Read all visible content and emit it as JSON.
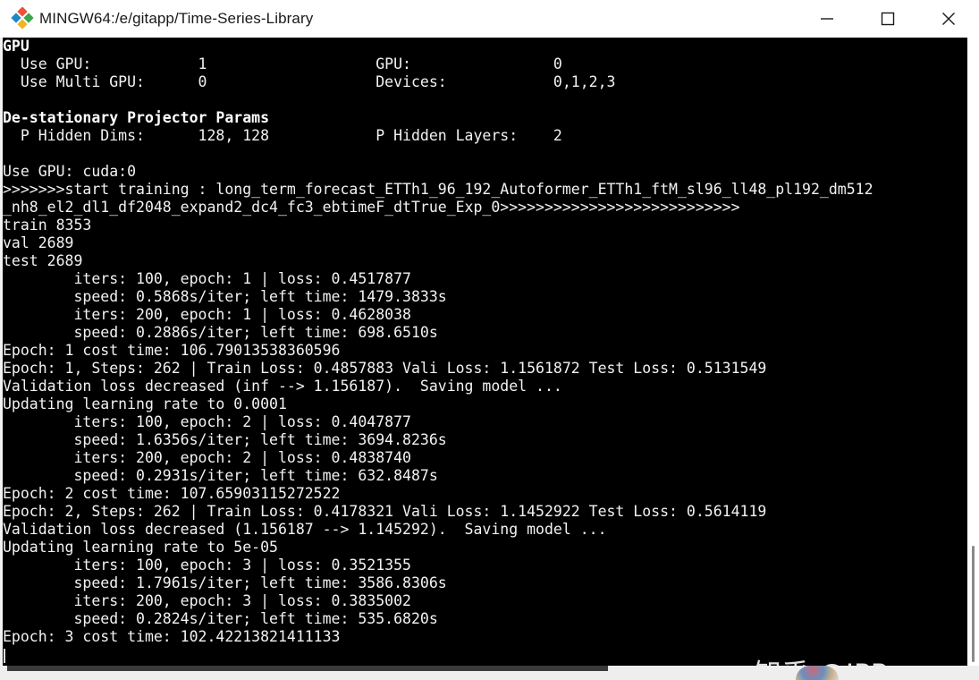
{
  "window": {
    "title": "MINGW64:/e/gitapp/Time-Series-Library",
    "app_icon": "git-bash-diamond-icon",
    "controls": {
      "minimize": "minimize-icon",
      "maximize": "maximize-icon",
      "close": "close-icon"
    }
  },
  "terminal": {
    "lines": [
      {
        "text": "GPU",
        "bold": true
      },
      {
        "text": "  Use GPU:            1                   GPU:                0",
        "bold": false
      },
      {
        "text": "  Use Multi GPU:      0                   Devices:            0,1,2,3",
        "bold": false
      },
      {
        "text": "",
        "bold": false
      },
      {
        "text": "De-stationary Projector Params",
        "bold": true
      },
      {
        "text": "  P Hidden Dims:      128, 128            P Hidden Layers:    2",
        "bold": false
      },
      {
        "text": "",
        "bold": false
      },
      {
        "text": "Use GPU: cuda:0",
        "bold": false
      },
      {
        "text": ">>>>>>>start training : long_term_forecast_ETTh1_96_192_Autoformer_ETTh1_ftM_sl96_ll48_pl192_dm512",
        "bold": false
      },
      {
        "text": "_nh8_el2_dl1_df2048_expand2_dc4_fc3_ebtimeF_dtTrue_Exp_0>>>>>>>>>>>>>>>>>>>>>>>>>>>",
        "bold": false
      },
      {
        "text": "train 8353",
        "bold": false
      },
      {
        "text": "val 2689",
        "bold": false
      },
      {
        "text": "test 2689",
        "bold": false
      },
      {
        "text": "        iters: 100, epoch: 1 | loss: 0.4517877",
        "bold": false
      },
      {
        "text": "        speed: 0.5868s/iter; left time: 1479.3833s",
        "bold": false
      },
      {
        "text": "        iters: 200, epoch: 1 | loss: 0.4628038",
        "bold": false
      },
      {
        "text": "        speed: 0.2886s/iter; left time: 698.6510s",
        "bold": false
      },
      {
        "text": "Epoch: 1 cost time: 106.79013538360596",
        "bold": false
      },
      {
        "text": "Epoch: 1, Steps: 262 | Train Loss: 0.4857883 Vali Loss: 1.1561872 Test Loss: 0.5131549",
        "bold": false
      },
      {
        "text": "Validation loss decreased (inf --> 1.156187).  Saving model ...",
        "bold": false
      },
      {
        "text": "Updating learning rate to 0.0001",
        "bold": false
      },
      {
        "text": "        iters: 100, epoch: 2 | loss: 0.4047877",
        "bold": false
      },
      {
        "text": "        speed: 1.6356s/iter; left time: 3694.8236s",
        "bold": false
      },
      {
        "text": "        iters: 200, epoch: 2 | loss: 0.4838740",
        "bold": false
      },
      {
        "text": "        speed: 0.2931s/iter; left time: 632.8487s",
        "bold": false
      },
      {
        "text": "Epoch: 2 cost time: 107.65903115272522",
        "bold": false
      },
      {
        "text": "Epoch: 2, Steps: 262 | Train Loss: 0.4178321 Vali Loss: 1.1452922 Test Loss: 0.5614119",
        "bold": false
      },
      {
        "text": "Validation loss decreased (1.156187 --> 1.145292).  Saving model ...",
        "bold": false
      },
      {
        "text": "Updating learning rate to 5e-05",
        "bold": false
      },
      {
        "text": "        iters: 100, epoch: 3 | loss: 0.3521355",
        "bold": false
      },
      {
        "text": "        speed: 1.7961s/iter; left time: 3586.8306s",
        "bold": false
      },
      {
        "text": "        iters: 200, epoch: 3 | loss: 0.3835002",
        "bold": false
      },
      {
        "text": "        speed: 0.2824s/iter; left time: 535.6820s",
        "bold": false
      },
      {
        "text": "Epoch: 3 cost time: 102.42213821411133",
        "bold": false
      }
    ]
  },
  "watermark": {
    "text": "知乎 @JPPeng"
  },
  "colors": {
    "terminal_bg": "#000000",
    "terminal_fg": "#f2f2f2",
    "titlebar_bg": "#ffffff"
  }
}
